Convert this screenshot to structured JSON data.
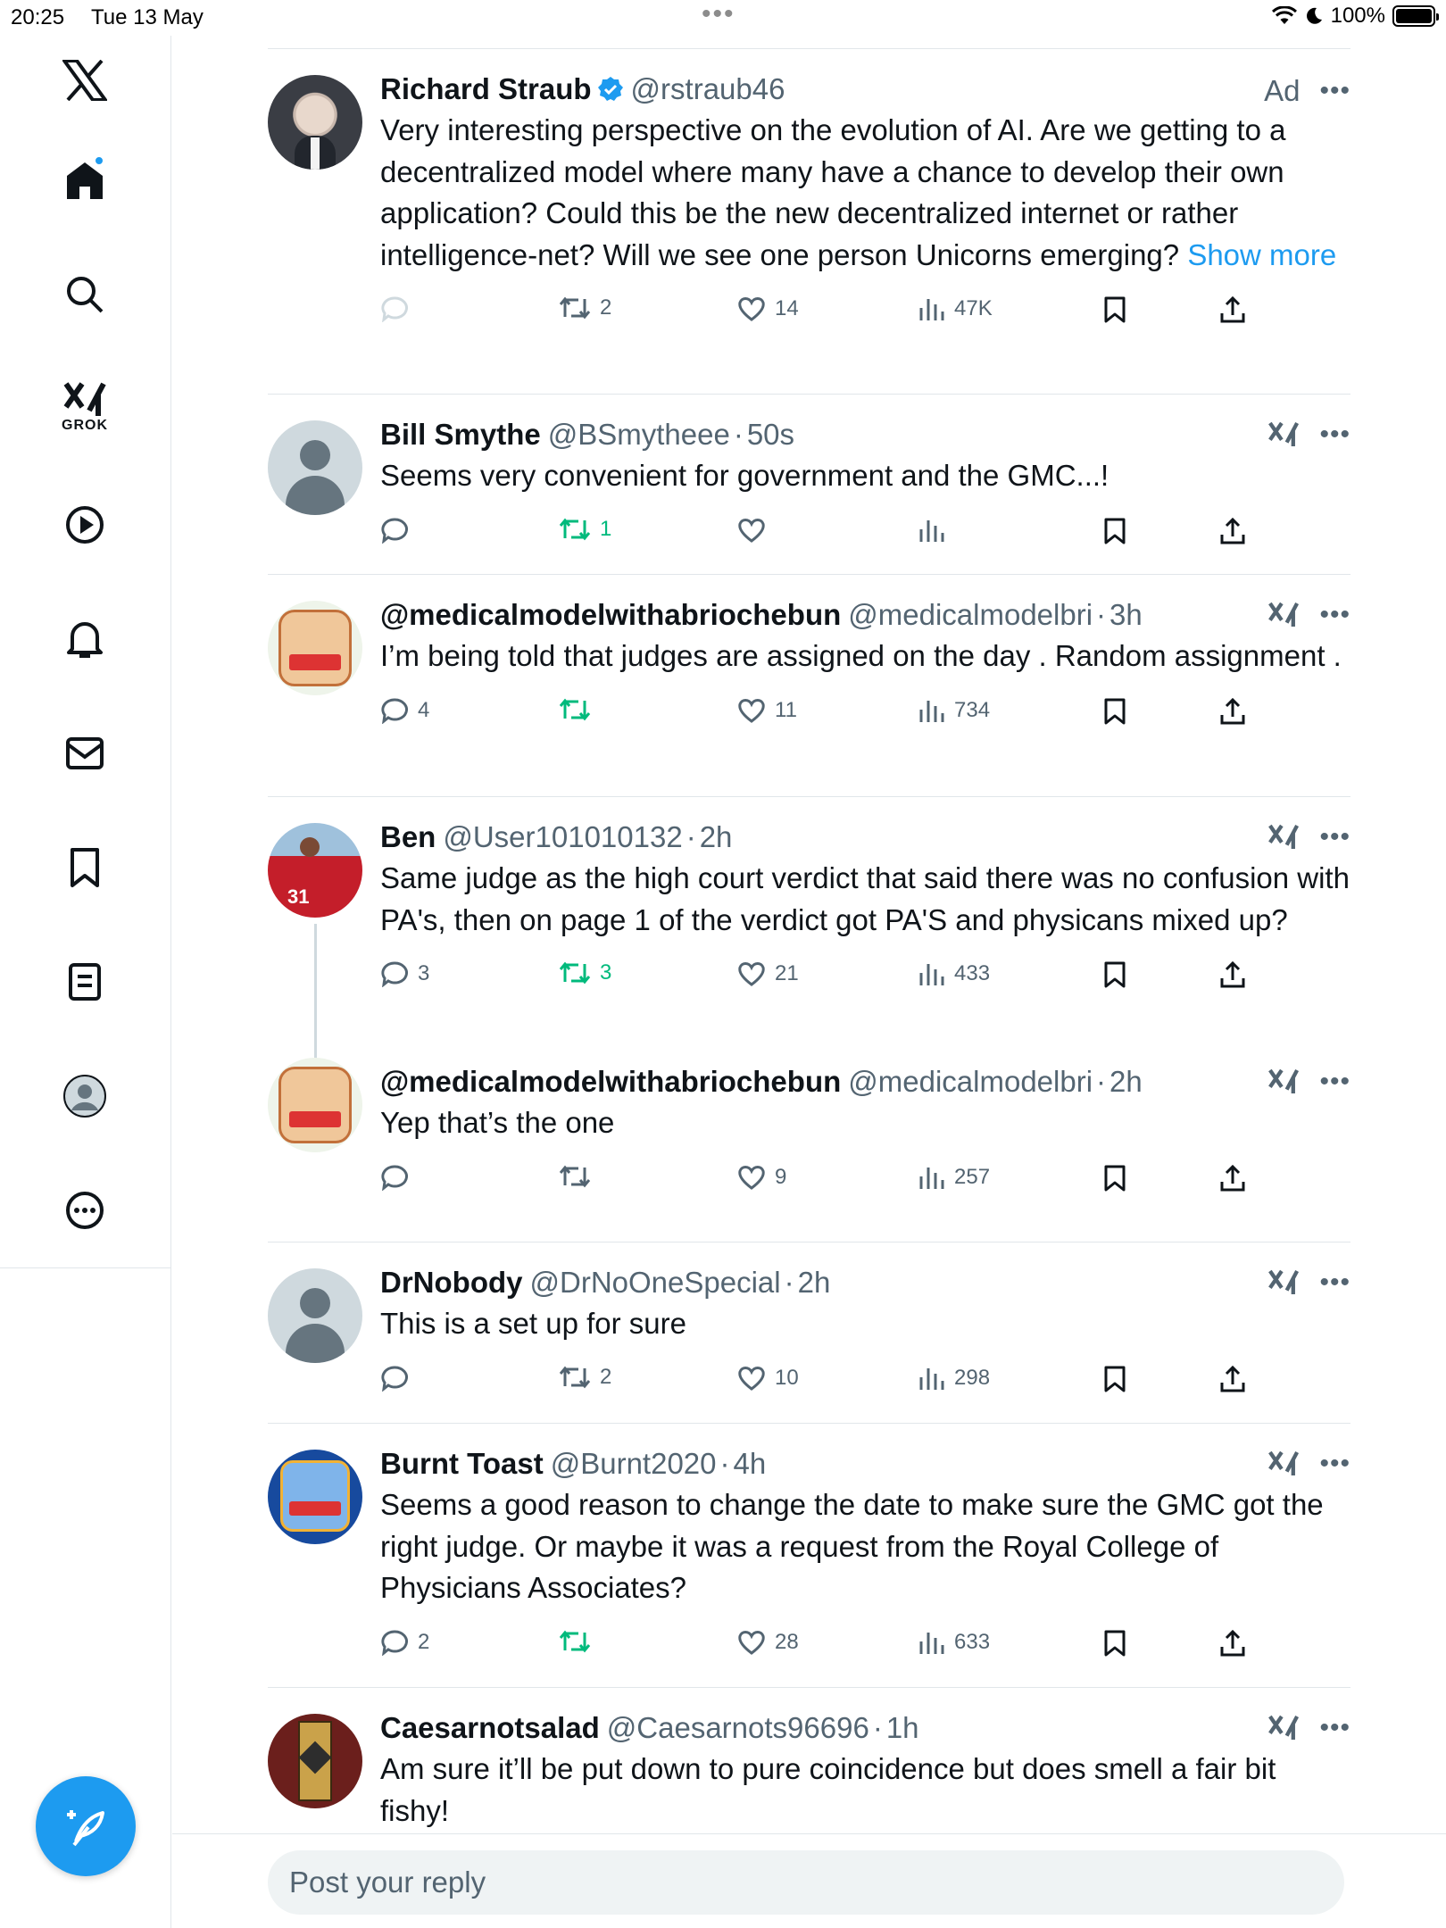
{
  "status_bar": {
    "time": "20:25",
    "date": "Tue 13 May",
    "battery": "100%"
  },
  "nav": {
    "grok_label": "GROK"
  },
  "colors": {
    "accent": "#1d9bf0",
    "repost_green": "#00ba7c",
    "secondary": "#536471"
  },
  "posts": [
    {
      "name": "Richard Straub",
      "handle": "@rstraub46",
      "time": "",
      "ad": "Ad",
      "text": "Very interesting perspective on the evolution of AI. Are we getting to a decentralized model where many have a chance to develop their own application? Could this be the new decentralized internet or rather intelligence-net? Will we see one person Unicorns emerging? ",
      "show_more": "Show more",
      "replies": "",
      "reposts": "2",
      "likes": "14",
      "views": "47K"
    },
    {
      "name": "Bill Smythe",
      "handle": "@BSmytheee",
      "time": "50s",
      "text": "Seems very convenient for government and the GMC...!",
      "replies": "",
      "reposts": "1",
      "likes": "",
      "views": ""
    },
    {
      "name": "@medicalmodelwithabriochebun",
      "handle": "@medicalmodelbri",
      "time": "3h",
      "text": "I’m being told that judges are assigned on the day . Random assignment .",
      "replies": "4",
      "reposts": "",
      "likes": "11",
      "views": "734"
    },
    {
      "name": "Ben",
      "handle": "@User101010132",
      "time": "2h",
      "text": "Same judge as the high court verdict that said there was no confusion with PA's, then on page 1 of the verdict got PA'S and physicans mixed up?",
      "replies": "3",
      "reposts": "3",
      "likes": "21",
      "views": "433"
    },
    {
      "name": "@medicalmodelwithabriochebun",
      "handle": "@medicalmodelbri",
      "time": "2h",
      "text": "Yep that’s the one",
      "replies": "",
      "reposts": "",
      "likes": "9",
      "views": "257"
    },
    {
      "name": "DrNobody",
      "handle": "@DrNoOneSpecial",
      "time": "2h",
      "text": "This is a set up for sure",
      "replies": "",
      "reposts": "2",
      "likes": "10",
      "views": "298"
    },
    {
      "name": "Burnt Toast",
      "handle": "@Burnt2020",
      "time": "4h",
      "text": "Seems a good reason to change the date to make sure the GMC got the right judge. Or maybe it was a request from the Royal College of Physicians Associates?",
      "replies": "2",
      "reposts": "",
      "likes": "28",
      "views": "633"
    },
    {
      "name": "Caesarnotsalad",
      "handle": "@Caesarnots96696",
      "time": "1h",
      "text": "Am sure it’ll be put down to pure coincidence but does smell a fair bit fishy!"
    }
  ],
  "reply_box": {
    "placeholder": "Post your reply"
  }
}
